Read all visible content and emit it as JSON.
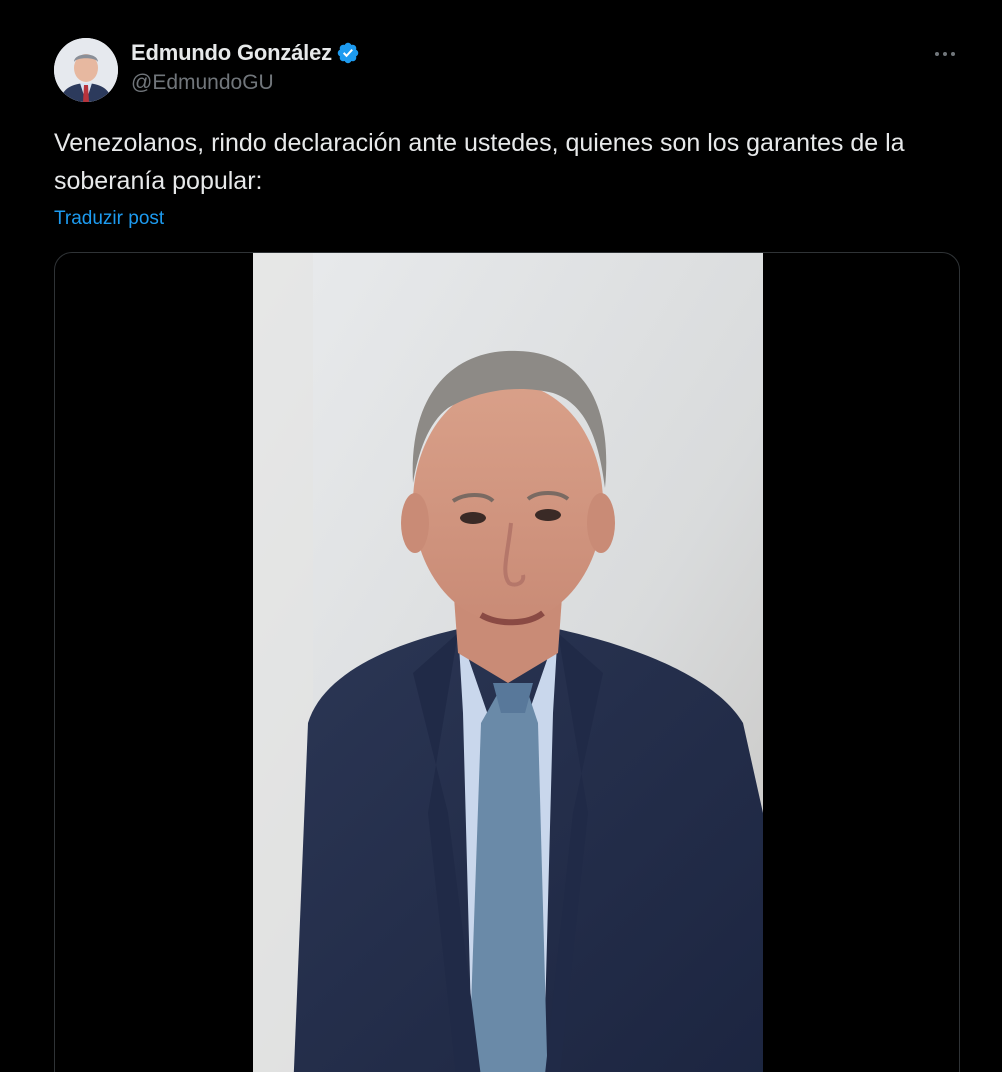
{
  "author": {
    "display_name": "Edmundo González",
    "handle": "@EdmundoGU",
    "verified_badge": "verified-badge-icon"
  },
  "post": {
    "text": "Venezolanos, rindo declaración ante ustedes, quienes son los garantes de la soberanía popular:",
    "translate_label": "Traduzir post"
  },
  "media": {
    "type": "video",
    "subject": "video-frame"
  },
  "colors": {
    "background": "#000000",
    "text_primary": "#e7e9ea",
    "text_secondary": "#71767b",
    "link": "#1d9bf0",
    "border": "#2f3336"
  }
}
